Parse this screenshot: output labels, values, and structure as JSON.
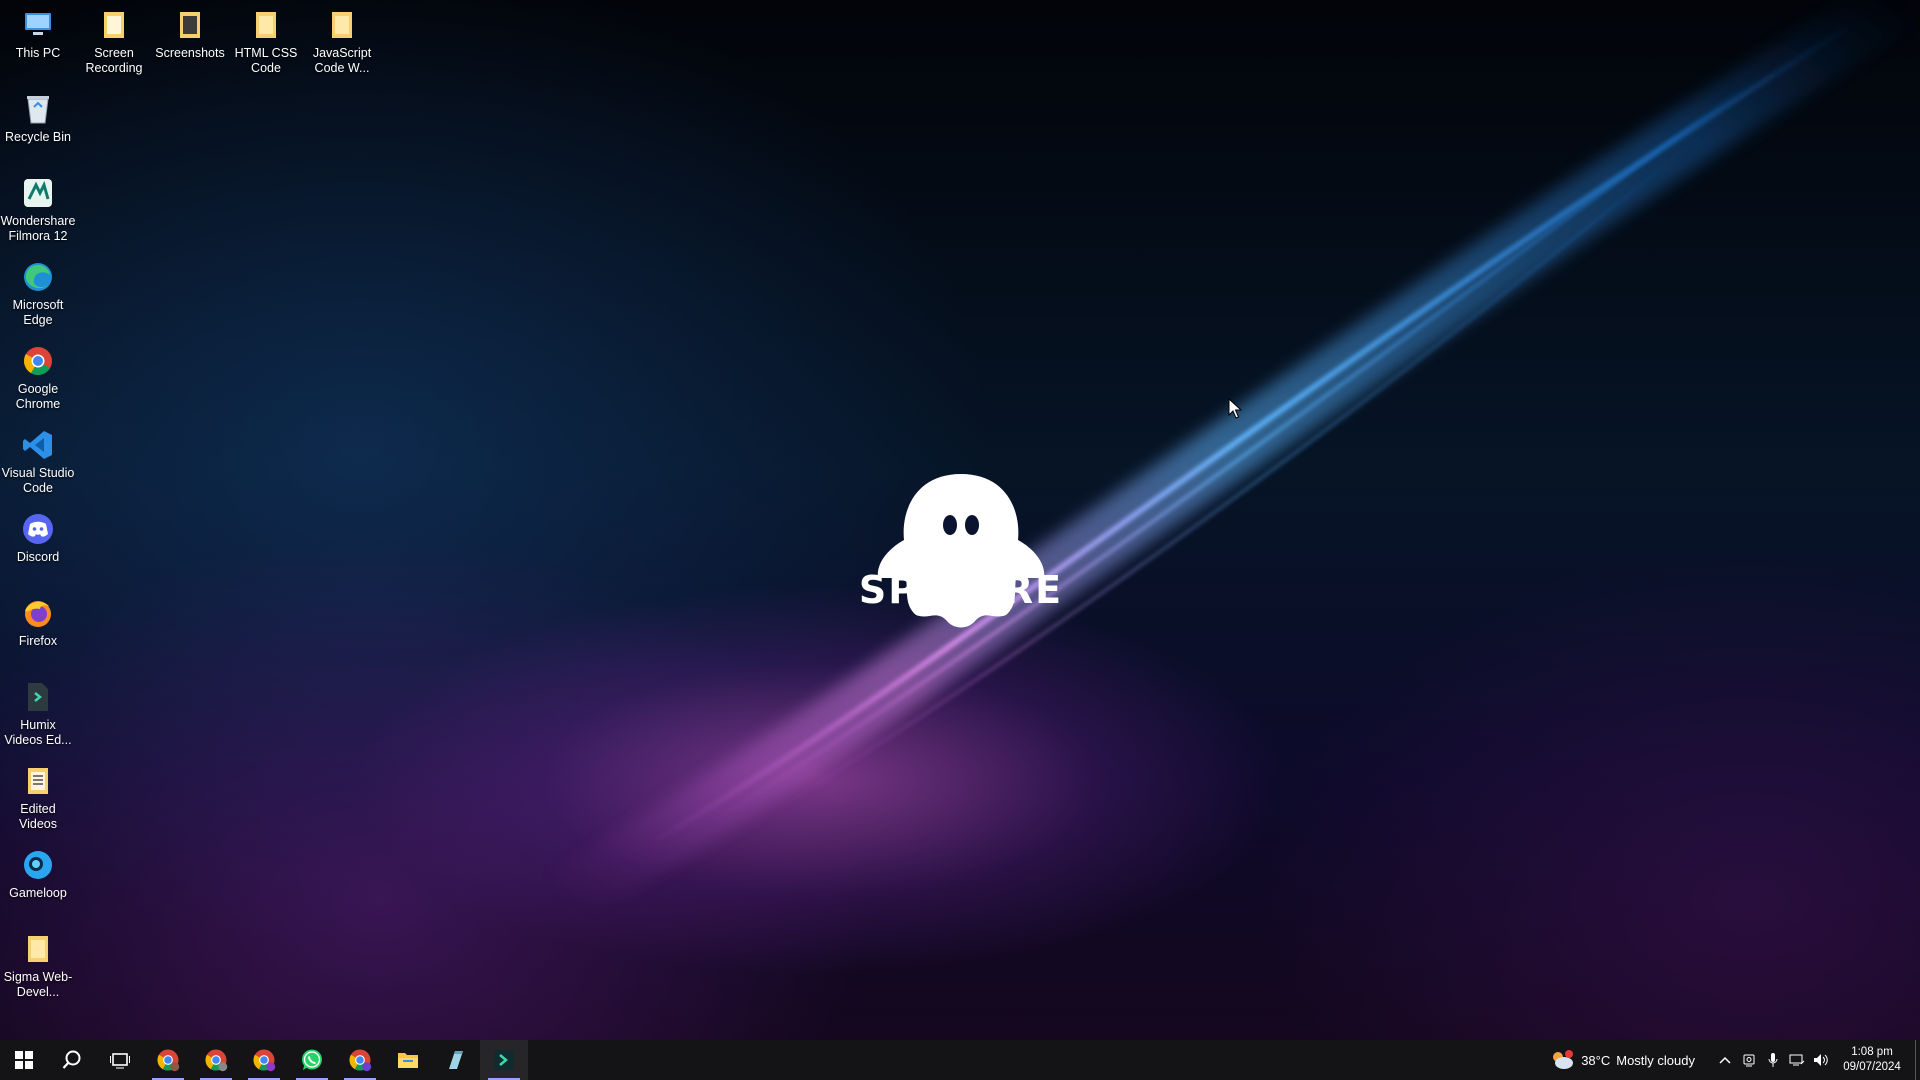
{
  "desktop": {
    "icons": [
      {
        "label": "This PC",
        "icon": "this-pc-icon"
      },
      {
        "label": "Screen Recording",
        "icon": "folder-icon"
      },
      {
        "label": "Screenshots",
        "icon": "folder-icon"
      },
      {
        "label": "HTML CSS Code",
        "icon": "folder-icon"
      },
      {
        "label": "JavaScript Code W...",
        "icon": "folder-icon"
      },
      {
        "label": "Recycle Bin",
        "icon": "recycle-bin-icon"
      },
      {
        "label": "Wondershare Filmora 12",
        "icon": "filmora-icon"
      },
      {
        "label": "Microsoft Edge",
        "icon": "edge-icon"
      },
      {
        "label": "Google Chrome",
        "icon": "chrome-icon"
      },
      {
        "label": "Visual Studio Code",
        "icon": "vscode-icon"
      },
      {
        "label": "Discord",
        "icon": "discord-icon"
      },
      {
        "label": "Firefox",
        "icon": "firefox-icon"
      },
      {
        "label": "Humix Videos Ed...",
        "icon": "file-icon"
      },
      {
        "label": "Edited Videos",
        "icon": "folder-icon"
      },
      {
        "label": "Gameloop",
        "icon": "gameloop-icon"
      },
      {
        "label": "Sigma Web-Devel...",
        "icon": "folder-icon"
      }
    ],
    "wallpaper_logo": "SPECTRE"
  },
  "taskbar": {
    "apps": [
      "start",
      "search",
      "task-view",
      "chrome",
      "chrome",
      "chrome",
      "whatsapp",
      "chrome",
      "file-explorer",
      "notepad",
      "filmora"
    ],
    "weather": {
      "temp": "38°C",
      "condition": "Mostly cloudy"
    },
    "clock": {
      "time": "1:08 pm",
      "date": "09/07/2024"
    }
  },
  "colors": {
    "taskbar_bg": "#0a0a0e",
    "folder": "#f4d06f",
    "streak_blue": "#3aa0ff",
    "streak_pink": "#d070e0"
  }
}
